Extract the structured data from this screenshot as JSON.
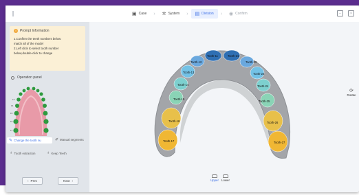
{
  "topbar": {
    "steps": [
      {
        "label": "Case",
        "icon": "briefcase-icon"
      },
      {
        "label": "System",
        "icon": "gear-icon"
      },
      {
        "label": "Division",
        "icon": "tooth-division-icon"
      },
      {
        "label": "Confirm",
        "icon": "check-circle-icon"
      }
    ]
  },
  "prompt": {
    "title": "Prompt Information",
    "lines": [
      "1.Confirm the teeth numbers below",
      "match all of the model",
      "2.Left click to select tooth number",
      "below,double-click to change"
    ]
  },
  "panel": {
    "title": "Operation panel"
  },
  "actions": {
    "change": "Change the tooth nu",
    "manual": "Manual segments",
    "extract": "Tooth extraction",
    "keep": "Keep Teeth"
  },
  "nav": {
    "prev": "Prev",
    "next": "Next"
  },
  "viewport": {
    "rotate": "Rotate",
    "upper": "Upper",
    "lower": "Lower",
    "teeth": [
      {
        "label": "Tooth-11",
        "color": "#2f6fb3"
      },
      {
        "label": "Tooth-21",
        "color": "#2f6fb3"
      },
      {
        "label": "Tooth-12",
        "color": "#6aa8de"
      },
      {
        "label": "Tooth-22",
        "color": "#6aa8de"
      },
      {
        "label": "Tooth-13",
        "color": "#73c2e6"
      },
      {
        "label": "Tooth-23",
        "color": "#73c2e6"
      },
      {
        "label": "Tooth-14",
        "color": "#7dd0cf"
      },
      {
        "label": "Tooth-24",
        "color": "#7dd0cf"
      },
      {
        "label": "Tooth-15",
        "color": "#8ad4b6"
      },
      {
        "label": "Tooth-25",
        "color": "#8ad4b6"
      },
      {
        "label": "Tooth-16",
        "color": "#e8c04a"
      },
      {
        "label": "Tooth-26",
        "color": "#e8c04a"
      },
      {
        "label": "Tooth-17",
        "color": "#f0b734"
      },
      {
        "label": "Tooth-27",
        "color": "#f0b734"
      }
    ]
  },
  "colors": {
    "accent": "#3c6fe6",
    "prompt_bg": "#fbf0d6",
    "gum": "#e89aa8",
    "tooth_dot": "#2e9a3e"
  },
  "chart_labels": [
    "17",
    "16",
    "15",
    "14",
    "13"
  ]
}
